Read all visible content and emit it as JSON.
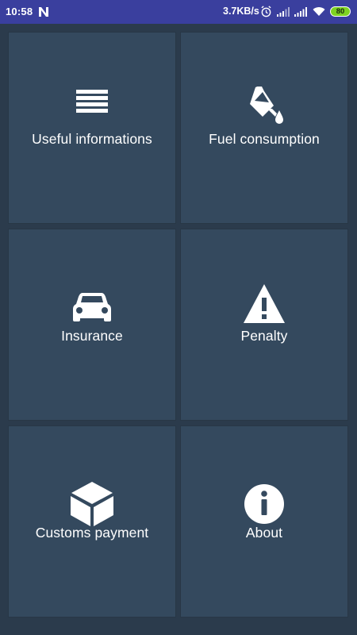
{
  "status_bar": {
    "time": "10:58",
    "network_speed": "3.7KB/s",
    "battery": "80",
    "notification_icon": "n-icon",
    "icons": [
      "alarm-icon",
      "signal-icon",
      "signal-icon",
      "wifi-icon",
      "battery-icon"
    ]
  },
  "menu": {
    "tiles": [
      {
        "label": "Useful informations",
        "icon": "list-icon"
      },
      {
        "label": "Fuel consumption",
        "icon": "paint-bucket-icon"
      },
      {
        "label": "Insurance",
        "icon": "car-icon"
      },
      {
        "label": "Penalty",
        "icon": "warning-icon"
      },
      {
        "label": "Customs payment",
        "icon": "box-icon"
      },
      {
        "label": "About",
        "icon": "info-icon"
      }
    ]
  },
  "colors": {
    "status_bar": "#3a3f9e",
    "background": "#2b3b4c",
    "tile": "#34495e",
    "icon": "#ffffff",
    "battery": "#7ed321"
  }
}
